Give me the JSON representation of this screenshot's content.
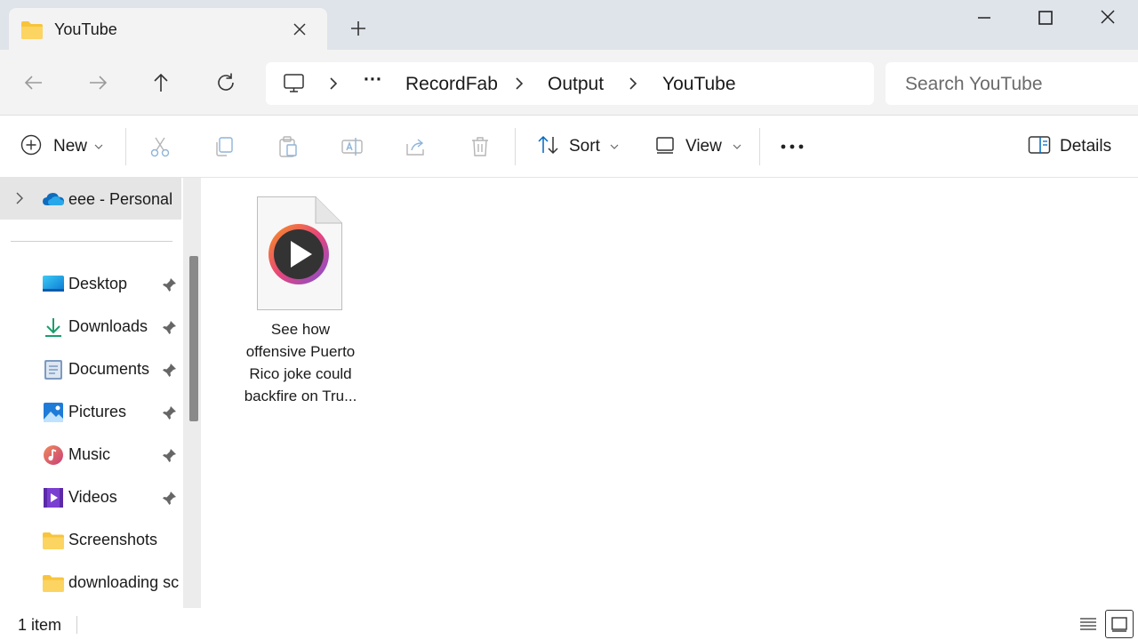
{
  "window": {
    "tab_title": "YouTube"
  },
  "address": {
    "crumbs": [
      "···",
      "RecordFab",
      "Output",
      "YouTube"
    ],
    "search_placeholder": "Search YouTube"
  },
  "commands": {
    "new_label": "New",
    "sort_label": "Sort",
    "view_label": "View",
    "details_label": "Details"
  },
  "sidebar": {
    "onedrive_label": "eee - Personal",
    "items": [
      {
        "label": "Desktop",
        "icon": "desktop-icon",
        "pinned": true
      },
      {
        "label": "Downloads",
        "icon": "downloads-icon",
        "pinned": true
      },
      {
        "label": "Documents",
        "icon": "documents-icon",
        "pinned": true
      },
      {
        "label": "Pictures",
        "icon": "pictures-icon",
        "pinned": true
      },
      {
        "label": "Music",
        "icon": "music-icon",
        "pinned": true
      },
      {
        "label": "Videos",
        "icon": "videos-icon",
        "pinned": true
      },
      {
        "label": "Screenshots",
        "icon": "folder-icon",
        "pinned": false
      },
      {
        "label": "downloading sc",
        "icon": "folder-icon",
        "pinned": false
      }
    ]
  },
  "files": [
    {
      "name": "See how offensive Puerto Rico joke could backfire on Tru...",
      "icon": "video-file-icon"
    }
  ],
  "status": {
    "count": "1 item"
  },
  "colors": {
    "titlebar": "#dfe3ea",
    "toolbar": "#f3f3f3",
    "accent": "#0067c0",
    "folder": "#f8c43c"
  }
}
